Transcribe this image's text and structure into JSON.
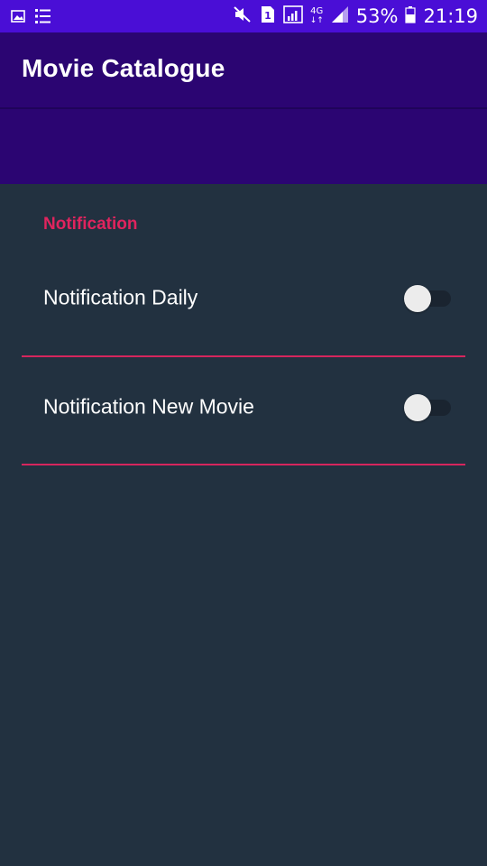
{
  "status_bar": {
    "battery_percent": "53%",
    "time": "21:19",
    "network_type": "4G",
    "sim_slot": "1",
    "icons": [
      "gallery-icon",
      "list-icon",
      "mute-icon",
      "sim-icon",
      "wifi-calling-icon",
      "network-4g-icon",
      "signal-icon",
      "battery-icon"
    ]
  },
  "toolbar": {
    "title": "Movie Catalogue"
  },
  "preferences": {
    "section_title": "Notification",
    "items": [
      {
        "label": "Notification Daily",
        "enabled": false
      },
      {
        "label": "Notification New Movie",
        "enabled": false
      }
    ]
  },
  "colors": {
    "status_bar": "#4a0ed6",
    "toolbar": "#2b0572",
    "background": "#223140",
    "accent": "#e0245e"
  }
}
